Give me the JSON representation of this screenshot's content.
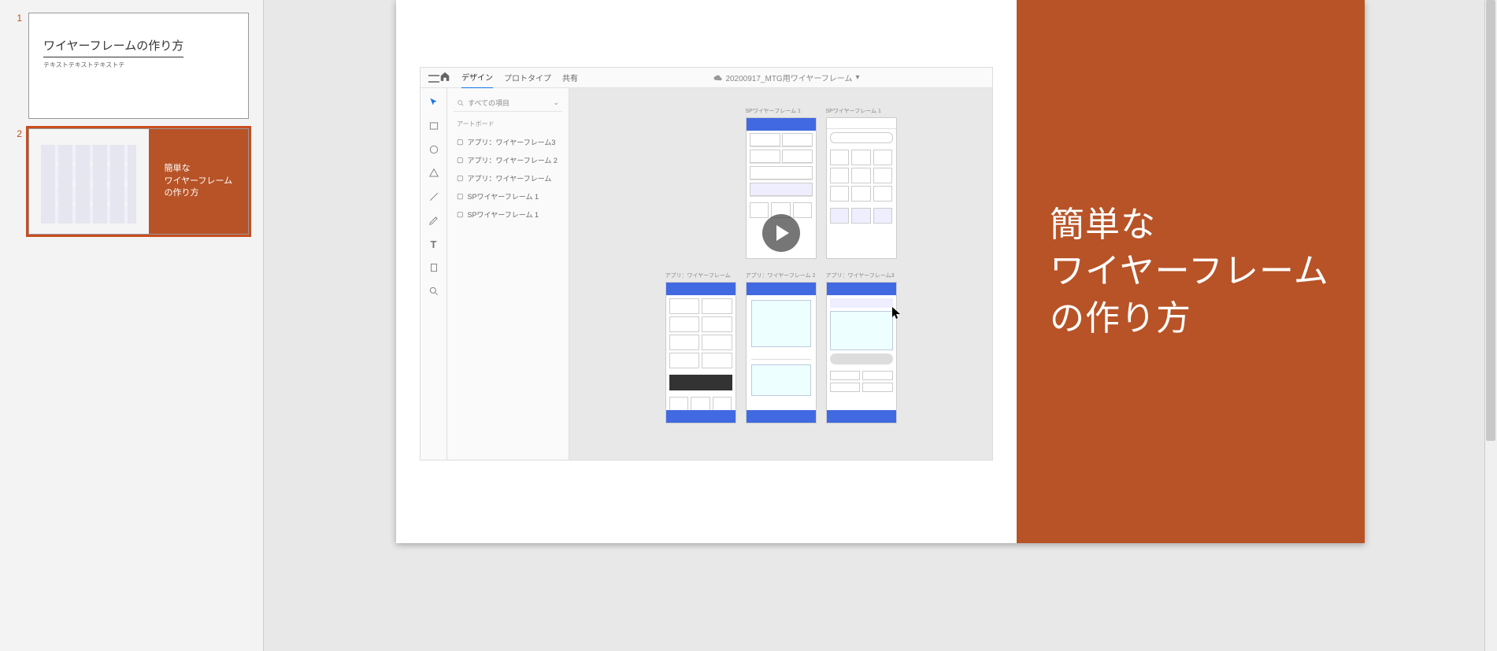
{
  "thumbnails": [
    {
      "num": "1",
      "title": "ワイヤーフレームの作り方",
      "subtitle": "テキストテキストテキストテ"
    },
    {
      "num": "2",
      "text": "簡単な\nワイヤーフレーム\nの作り方"
    }
  ],
  "slide": {
    "title_line1": "簡単な",
    "title_line2": "ワイヤーフレーム",
    "title_line3": "の作り方"
  },
  "xd": {
    "tabs": {
      "design": "デザイン",
      "prototype": "プロトタイプ",
      "share": "共有"
    },
    "filename": "20200917_MTG用ワイヤーフレーム",
    "search_label": "すべての項目",
    "side_section": "アートボード",
    "layers": [
      "アプリ：ワイヤーフレーム3",
      "アプリ：ワイヤーフレーム 2",
      "アプリ：ワイヤーフレーム",
      "SPワイヤーフレーム 1",
      "SPワイヤーフレーム 1"
    ],
    "artboard_labels": {
      "sp1": "SPワイヤーフレーム 1",
      "sp2": "SPワイヤーフレーム 1",
      "app1": "アプリ：ワイヤーフレーム",
      "app2": "アプリ：ワイヤーフレーム 2",
      "app3": "アプリ：ワイヤーフレーム3"
    }
  }
}
